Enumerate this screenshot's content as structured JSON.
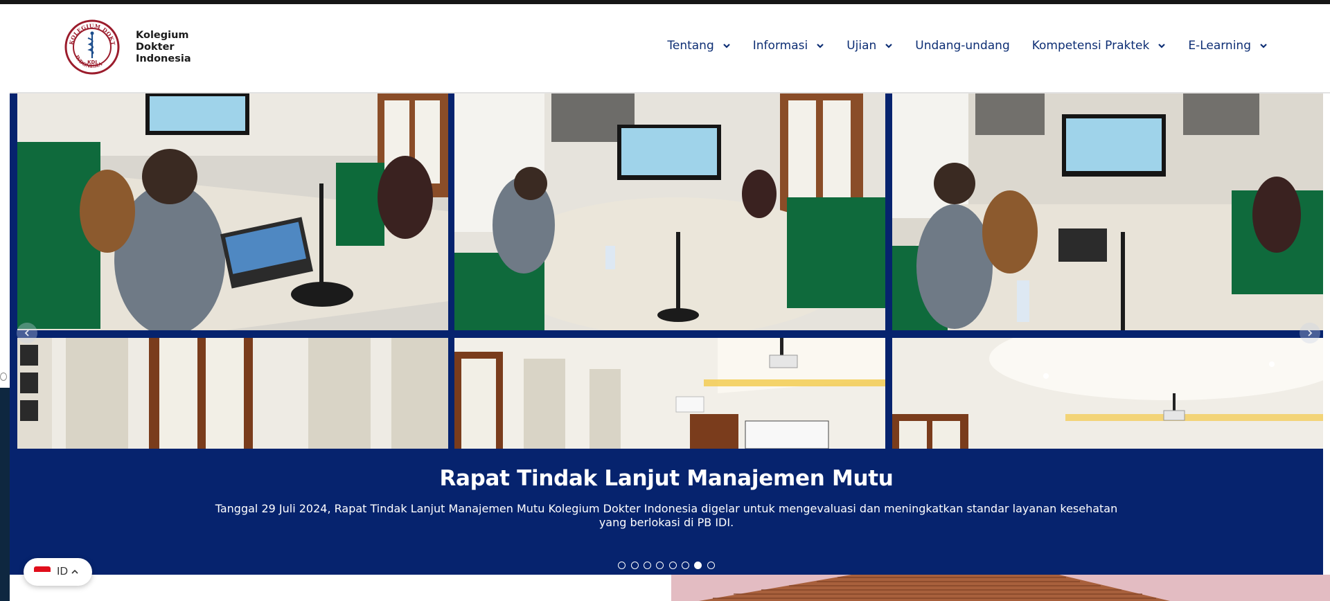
{
  "brand": {
    "name_line1": "Kolegium",
    "name_line2": "Dokter",
    "name_line3": "Indonesia",
    "seal_text": "KOLEGIUM DOKTER INDONESIA",
    "seal_center": "KDI"
  },
  "nav": {
    "items": [
      {
        "label": "Tentang",
        "has_dropdown": true
      },
      {
        "label": "Informasi",
        "has_dropdown": true
      },
      {
        "label": "Ujian",
        "has_dropdown": true
      },
      {
        "label": "Undang-undang",
        "has_dropdown": false
      },
      {
        "label": "Kompetensi Praktek",
        "has_dropdown": true
      },
      {
        "label": "E-Learning",
        "has_dropdown": true
      }
    ]
  },
  "slider": {
    "title": "Rapat Tindak Lanjut Manajemen Mutu",
    "description": "Tanggal 29 Juli 2024, Rapat Tindak Lanjut Manajemen Mutu Kolegium Dokter Indonesia digelar untuk mengevaluasi dan meningkatkan standar layanan kesehatan yang berlokasi di PB IDI.",
    "slide_count": 8,
    "active_slide": 7,
    "prev_icon": "chevron-left-icon",
    "next_icon": "chevron-right-icon"
  },
  "language": {
    "code": "ID",
    "flag": "indonesia-flag-icon"
  },
  "colors": {
    "nav_text": "#0d2e74",
    "slider_bg": "#06236e",
    "accent_red": "#9b1c2c"
  }
}
